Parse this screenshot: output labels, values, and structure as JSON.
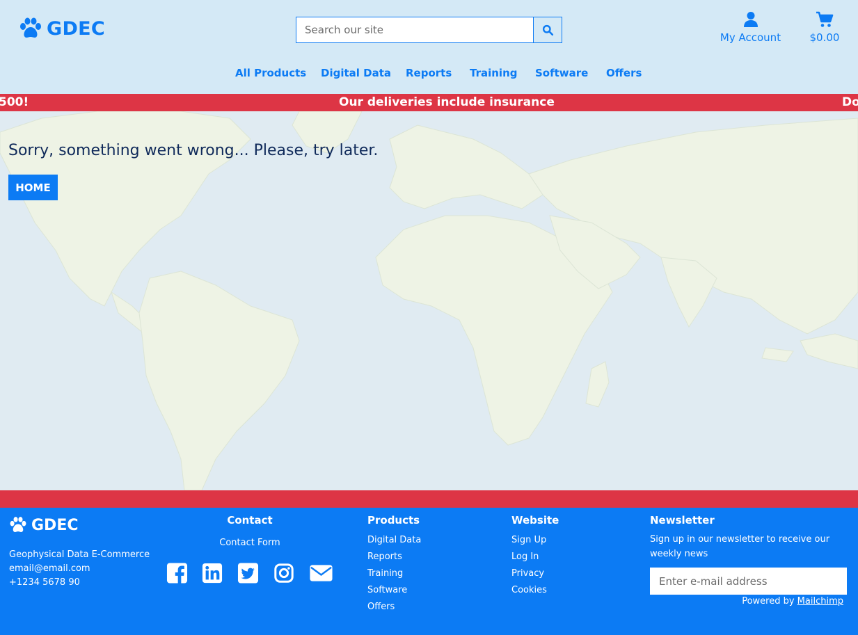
{
  "brand": {
    "name": "GDEC",
    "icon": "paw-icon",
    "color": "#0c7bf4"
  },
  "header": {
    "search_placeholder": "Search our site",
    "account_label": "My Account",
    "cart_total": "$0.00"
  },
  "nav": [
    {
      "label": "All Products"
    },
    {
      "label": "Digital Data"
    },
    {
      "label": "Reports"
    },
    {
      "label": "Training"
    },
    {
      "label": "Software"
    },
    {
      "label": "Offers"
    }
  ],
  "ticker": {
    "left_fragment": "500!",
    "center": "Our deliveries include insurance",
    "right_fragment": "Do"
  },
  "error": {
    "message": "Sorry, something went wrong... Please, try later.",
    "home_label": "HOME"
  },
  "footer": {
    "brand": "GDEC",
    "info": [
      "Geophysical Data E-Commerce",
      "email@email.com",
      "+1234 5678 90"
    ],
    "contact": {
      "title": "Contact",
      "link": "Contact Form"
    },
    "socials": [
      "facebook-icon",
      "linkedin-icon",
      "twitter-icon",
      "instagram-icon",
      "envelope-icon"
    ],
    "products": {
      "title": "Products",
      "items": [
        "Digital Data",
        "Reports",
        "Training",
        "Software",
        "Offers"
      ]
    },
    "website": {
      "title": "Website",
      "items": [
        "Sign Up",
        "Log In",
        "Privacy",
        "Cookies"
      ]
    },
    "newsletter": {
      "title": "Newsletter",
      "description": "Sign up in our newsletter to receive our weekly news",
      "placeholder": "Enter e-mail address",
      "powered_prefix": "Powered by ",
      "powered_link": "Mailchimp"
    }
  },
  "colors": {
    "primary": "#0c7bf4",
    "header_bg": "#d4e9f6",
    "alert_red": "#dd3545",
    "error_text": "#102a5a"
  }
}
